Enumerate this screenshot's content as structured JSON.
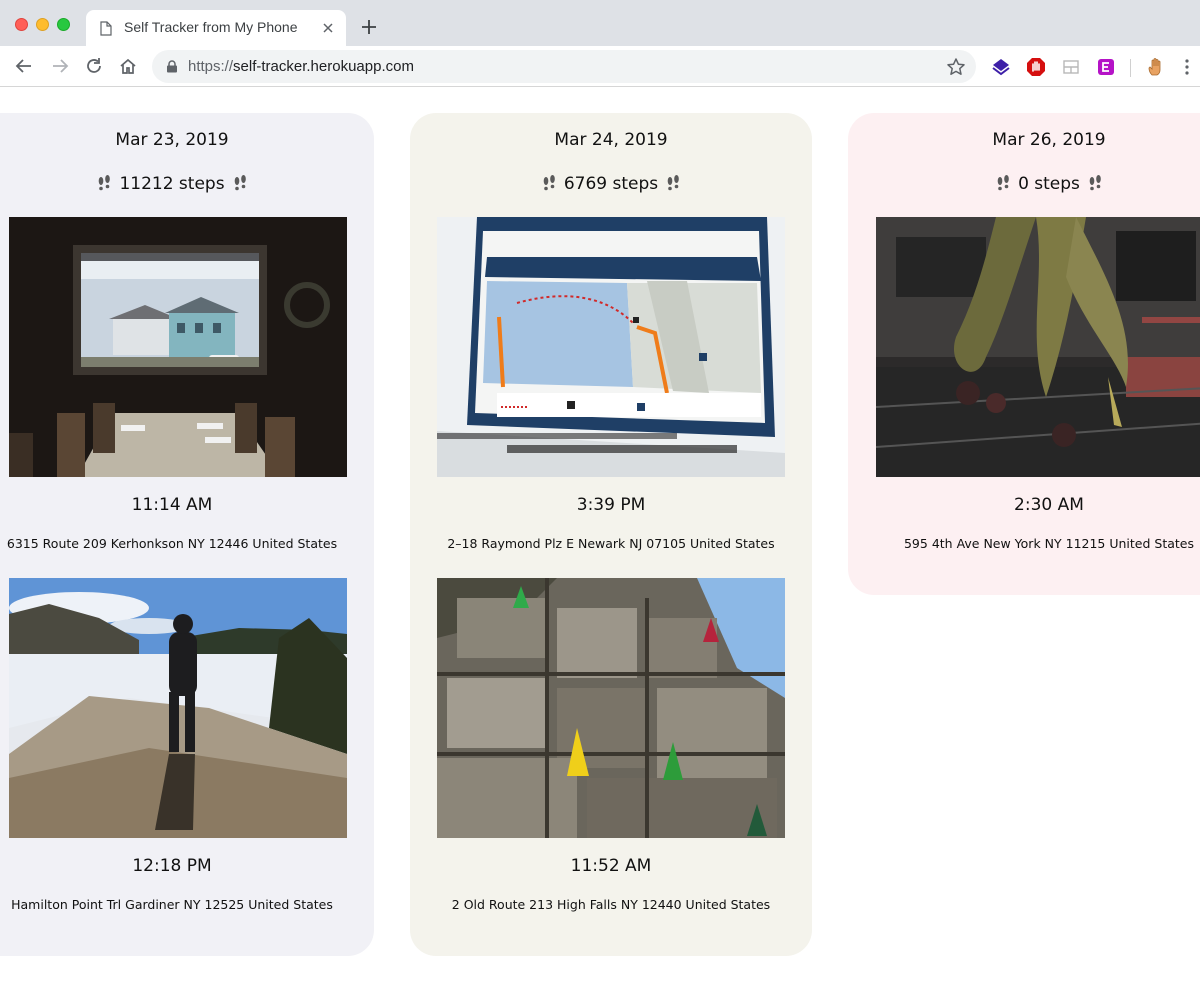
{
  "browser": {
    "tab_title": "Self Tracker from My Phone",
    "url_scheme": "https://",
    "url_host": "self-tracker.herokuapp.com"
  },
  "days": [
    {
      "date": "Mar 23, 2019",
      "steps": "11212 steps",
      "background": "#f1f1f6",
      "entries": [
        {
          "photo": "window-dining-room",
          "time": "11:14 AM",
          "address": "6315 Route 209 Kerhonkson NY 12446 United States"
        },
        {
          "photo": "frozen-lake-silhouette",
          "time": "12:18 PM",
          "address": "Hamilton Point Trl Gardiner NY 12525 United States"
        }
      ]
    },
    {
      "date": "Mar 24, 2019",
      "steps": "6769 steps",
      "background": "#f4f3ec",
      "entries": [
        {
          "photo": "ferry-map-sign",
          "time": "3:39 PM",
          "address": "2–18 Raymond Plz E Newark NJ 07105 United States"
        },
        {
          "photo": "rock-wall-gnomes",
          "time": "11:52 AM",
          "address": "2 Old Route 213 High Falls NY 12440 United States"
        }
      ]
    },
    {
      "date": "Mar 26, 2019",
      "steps": "0 steps",
      "background": "#fdf0f2",
      "entries": [
        {
          "photo": "dried-flowers-window",
          "time": "2:30 AM",
          "address": "595 4th Ave New York NY 11215 United States"
        }
      ]
    }
  ]
}
